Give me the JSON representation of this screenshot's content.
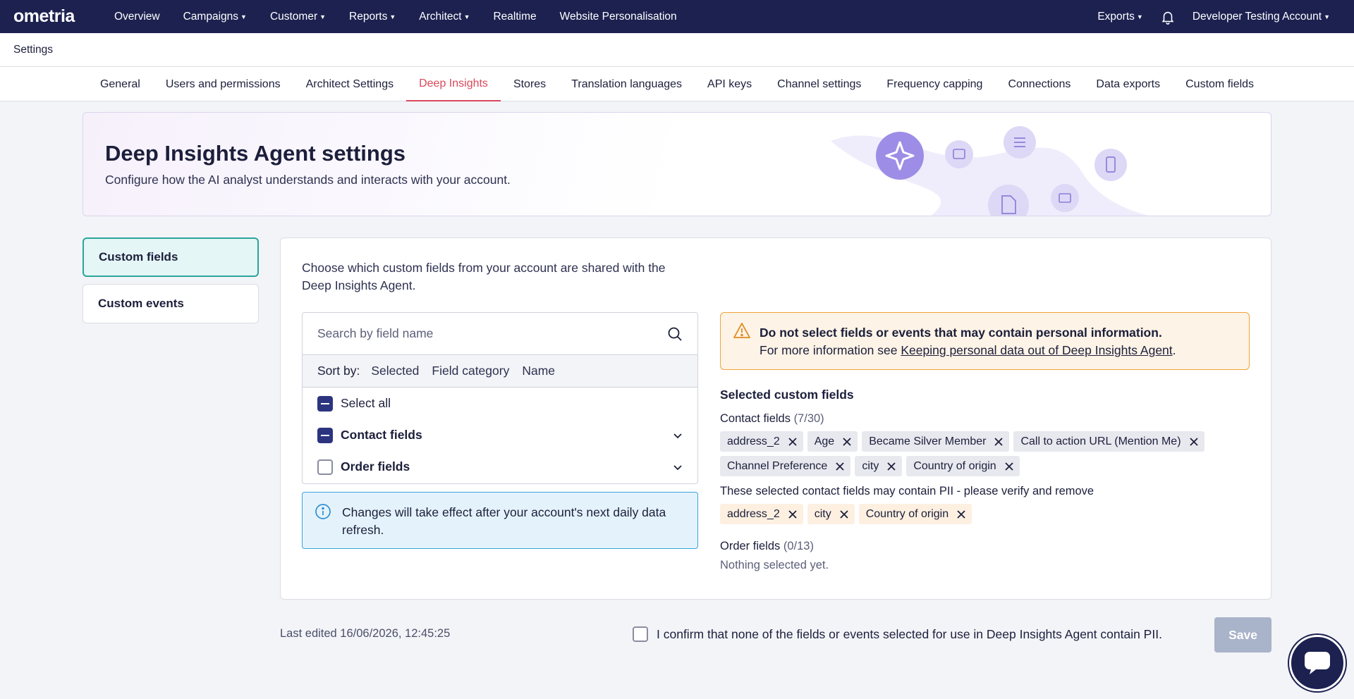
{
  "nav": {
    "logo": "ometria",
    "items": [
      "Overview",
      "Campaigns",
      "Customer",
      "Reports",
      "Architect",
      "Realtime",
      "Website Personalisation"
    ],
    "dropdown_flags": [
      false,
      true,
      true,
      true,
      true,
      false,
      false
    ],
    "exports": "Exports",
    "account": "Developer Testing Account"
  },
  "settings_title": "Settings",
  "tabs": [
    "General",
    "Users and permissions",
    "Architect Settings",
    "Deep Insights",
    "Stores",
    "Translation languages",
    "API keys",
    "Channel settings",
    "Frequency capping",
    "Connections",
    "Data exports",
    "Custom fields"
  ],
  "active_tab": "Deep Insights",
  "hero": {
    "title": "Deep Insights Agent settings",
    "subtitle": "Configure how the AI analyst understands and interacts with your account."
  },
  "left_menu": {
    "items": [
      "Custom fields",
      "Custom events"
    ],
    "active": "Custom fields"
  },
  "panel": {
    "intro": "Choose which custom fields from your account are shared with the Deep Insights Agent.",
    "search_placeholder": "Search by field name",
    "sort_label": "Sort by:",
    "sort_options": [
      "Selected",
      "Field category",
      "Name"
    ],
    "select_all": "Select all",
    "categories": [
      {
        "label": "Contact fields",
        "state": "indeterminate"
      },
      {
        "label": "Order fields",
        "state": "unchecked"
      }
    ],
    "info_message": "Changes will take effect after your account's next daily data refresh.",
    "warning": {
      "bold": "Do not select fields or events that may contain personal information.",
      "text": "For more information see ",
      "link": "Keeping personal data out of Deep Insights Agent",
      "suffix": "."
    },
    "selected_heading": "Selected custom fields",
    "contact_label": "Contact fields",
    "contact_count": "(7/30)",
    "contact_chips": [
      "address_2",
      "Age",
      "Became Silver Member",
      "Call to action URL (Mention Me)",
      "Channel Preference",
      "city",
      "Country of origin"
    ],
    "pii_note": "These selected contact fields may contain PII - please verify and remove",
    "pii_chips": [
      "address_2",
      "city",
      "Country of origin"
    ],
    "order_label": "Order fields",
    "order_count": "(0/13)",
    "order_empty": "Nothing selected yet."
  },
  "footer": {
    "last_edited": "Last edited 16/06/2026, 12:45:25",
    "confirm_text": "I confirm that none of the fields or events selected for use in Deep Insights Agent contain PII.",
    "save": "Save"
  },
  "colors": {
    "nav_bg": "#1c2150",
    "accent_tab": "#d9485a",
    "active_menu_border": "#2aa59a",
    "checkbox_fill": "#2c3480",
    "warning_border": "#f2a33a",
    "info_border": "#3ca4db",
    "save_disabled": "#a9b3c9"
  },
  "icons": [
    "bell-icon",
    "search-icon",
    "chevron-down-icon",
    "info-icon",
    "warning-icon",
    "close-icon",
    "chat-icon",
    "sparkle-icon"
  ]
}
